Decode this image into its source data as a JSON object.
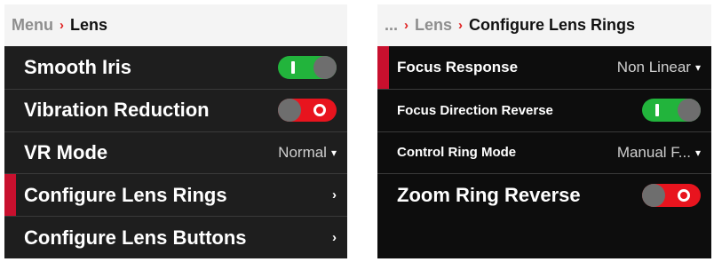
{
  "left": {
    "breadcrumb": {
      "parent": "Menu",
      "separator": "›",
      "current": "Lens"
    },
    "items": [
      {
        "label": "Smooth Iris",
        "toggle": "on"
      },
      {
        "label": "Vibration Reduction",
        "toggle": "off"
      },
      {
        "label": "VR Mode",
        "value": "Normal",
        "caret": "▾"
      },
      {
        "label": "Configure Lens Rings",
        "chevron": "›",
        "selected": true
      },
      {
        "label": "Configure Lens Buttons",
        "chevron": "›"
      }
    ]
  },
  "right": {
    "breadcrumb": {
      "ellipsis": "...",
      "separator": "›",
      "parent": "Lens",
      "current": "Configure Lens Rings"
    },
    "items": [
      {
        "label": "Focus Response",
        "value": "Non Linear",
        "caret": "▾",
        "selected": true
      },
      {
        "label": "Focus Direction Reverse",
        "toggle": "on"
      },
      {
        "label": "Control Ring Mode",
        "value": "Manual F...",
        "caret": "▾"
      },
      {
        "label": "Zoom Ring Reverse",
        "toggle": "off"
      }
    ]
  },
  "colors": {
    "accent_red": "#c8102e",
    "toggle_on": "#22b43c",
    "toggle_off": "#e8141e",
    "panel_bg": "#1e1e1e",
    "breadcrumb_bg": "#f4f4f4"
  },
  "icons": {
    "separator": "chevron-right-icon",
    "caret": "caret-down-icon",
    "chevron": "chevron-right-icon",
    "toggle": "toggle-switch-icon"
  }
}
